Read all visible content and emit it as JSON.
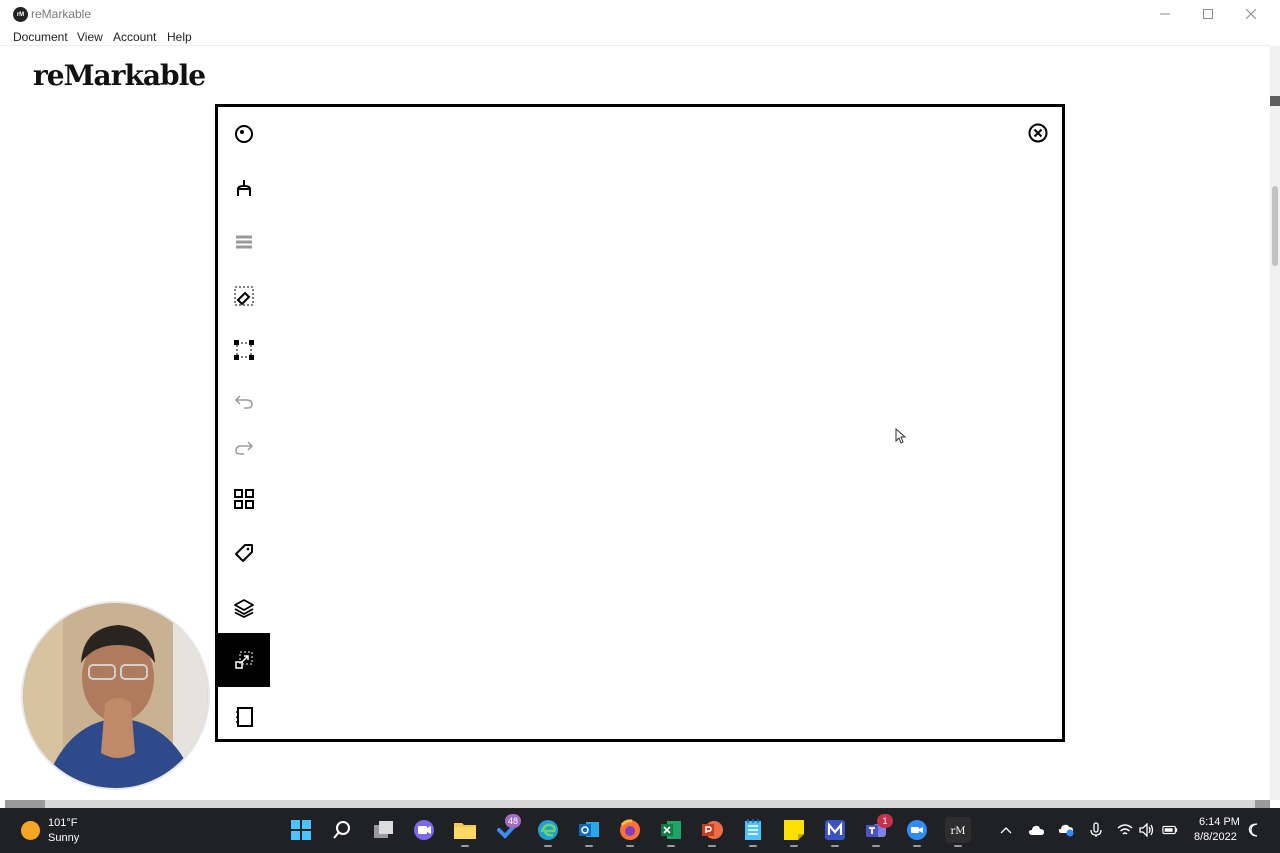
{
  "window": {
    "app_icon_text": "rM",
    "title": "reMarkable"
  },
  "menu": {
    "items": [
      "Document",
      "View",
      "Account",
      "Help"
    ]
  },
  "brand": "reMarkable",
  "toolbar": {
    "tools": [
      {
        "name": "hide-menu",
        "icon": "circle-dot-icon",
        "enabled": true
      },
      {
        "name": "writing-tools",
        "icon": "pen-tip-icon",
        "enabled": true
      },
      {
        "name": "text-formatting",
        "icon": "text-lines-icon",
        "enabled": false
      },
      {
        "name": "eraser",
        "icon": "eraser-icon",
        "enabled": true
      },
      {
        "name": "selection",
        "icon": "selection-icon",
        "enabled": true
      },
      {
        "name": "undo",
        "icon": "undo-icon",
        "enabled": false
      },
      {
        "name": "redo",
        "icon": "redo-icon",
        "enabled": false
      },
      {
        "name": "page-overview",
        "icon": "grid-icon",
        "enabled": true
      },
      {
        "name": "tags",
        "icon": "tag-icon",
        "enabled": true
      },
      {
        "name": "layers",
        "icon": "layers-icon",
        "enabled": true
      },
      {
        "name": "move-page",
        "icon": "move-selection-icon",
        "enabled": true,
        "active": true
      },
      {
        "name": "notebook",
        "icon": "notebook-icon",
        "enabled": true
      }
    ],
    "close_icon": "close-circle-icon"
  },
  "colors": {
    "accent": "#000000",
    "taskbar": "#202124",
    "disabled_icon": "#9a9a9a"
  },
  "taskbar": {
    "weather": {
      "temperature": "101°F",
      "condition": "Sunny",
      "icon": "sun-icon"
    },
    "apps": [
      {
        "name": "start",
        "icon": "windows-start-icon"
      },
      {
        "name": "search",
        "icon": "search-icon"
      },
      {
        "name": "task-view",
        "icon": "task-view-icon"
      },
      {
        "name": "teams-chat",
        "icon": "chat-camera-icon"
      },
      {
        "name": "file-explorer",
        "icon": "folder-icon",
        "running": true
      },
      {
        "name": "todo",
        "icon": "checkmark-icon",
        "badge": "48"
      },
      {
        "name": "edge",
        "icon": "edge-icon",
        "running": true
      },
      {
        "name": "outlook",
        "icon": "outlook-icon",
        "running": true
      },
      {
        "name": "firefox",
        "icon": "firefox-icon",
        "running": true
      },
      {
        "name": "excel",
        "icon": "excel-icon",
        "running": true
      },
      {
        "name": "powerpoint",
        "icon": "powerpoint-icon",
        "running": true
      },
      {
        "name": "notepad",
        "icon": "notepad-icon",
        "running": true
      },
      {
        "name": "sticky-notes",
        "icon": "sticky-notes-icon",
        "running": true
      },
      {
        "name": "app-m",
        "icon": "m-app-icon",
        "running": true
      },
      {
        "name": "teams",
        "icon": "teams-icon",
        "badge": "1",
        "running": true
      },
      {
        "name": "zoom",
        "icon": "zoom-icon",
        "running": true
      },
      {
        "name": "remarkable",
        "icon": "remarkable-icon",
        "running": true
      }
    ],
    "tray": [
      "chevron-up-icon",
      "cloud-icon",
      "onedrive-icon",
      "microphone-icon",
      "wifi-icon",
      "volume-icon",
      "battery-icon"
    ],
    "time": "6:14 PM",
    "date": "8/8/2022",
    "notification_icon": "moon-icon"
  }
}
